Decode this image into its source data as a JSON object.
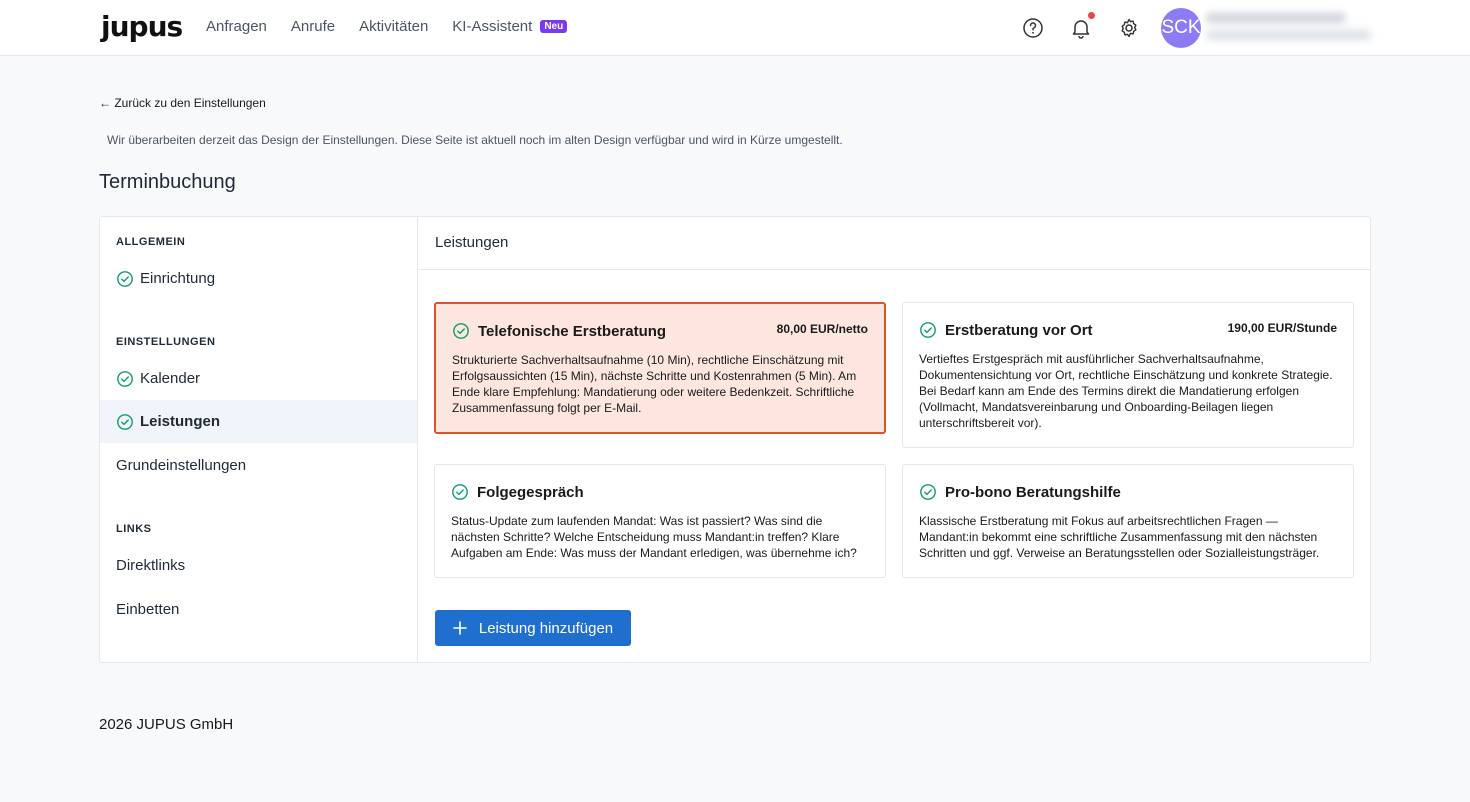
{
  "nav": {
    "logo": "jupus",
    "links": [
      "Anfragen",
      "Anrufe",
      "Aktivitäten",
      "KI-Assistent"
    ],
    "new_badge": "Neu",
    "avatar_initials": "SCK"
  },
  "page": {
    "back_link": "← Zurück zu den Einstellungen",
    "notice": "Wir überarbeiten derzeit das Design der Einstellungen. Diese Seite ist aktuell noch im alten Design verfügbar und wird in Kürze umgestellt.",
    "title": "Terminbuchung"
  },
  "sidebar": {
    "sections": [
      {
        "title": "ALLGEMEIN",
        "items": [
          {
            "label": "Einrichtung",
            "checked": true
          }
        ]
      },
      {
        "title": "EINSTELLUNGEN",
        "items": [
          {
            "label": "Kalender",
            "checked": true
          },
          {
            "label": "Leistungen",
            "checked": true,
            "active": true
          },
          {
            "label": "Grundeinstellungen",
            "checked": false
          }
        ]
      },
      {
        "title": "LINKS",
        "items": [
          {
            "label": "Direktlinks",
            "checked": false
          },
          {
            "label": "Einbetten",
            "checked": false
          }
        ]
      }
    ]
  },
  "content": {
    "header": "Leistungen",
    "services": [
      {
        "title": "Telefonische Erstberatung",
        "price": "80,00 EUR/netto",
        "selected": true,
        "description": "Strukturierte Sachverhaltsaufnahme (10 Min), rechtliche Einschätzung mit Erfolgsaussichten (15 Min), nächste Schritte und Kostenrahmen (5 Min). Am Ende klare Empfehlung: Mandatierung oder weitere Bedenkzeit. Schriftliche Zusammenfassung folgt per E-Mail."
      },
      {
        "title": "Erstberatung vor Ort",
        "price": "190,00 EUR/Stunde",
        "selected": false,
        "description": "Vertieftes Erstgespräch mit ausführlicher Sachverhaltsaufnahme, Dokumentensichtung vor Ort, rechtliche Einschätzung und konkrete Strategie. Bei Bedarf kann am Ende des Termins direkt die Mandatierung erfolgen (Vollmacht, Mandatsvereinbarung und Onboarding-Beilagen liegen unterschriftsbereit vor)."
      },
      {
        "title": "Folgegespräch",
        "price": "",
        "selected": false,
        "description": "Status-Update zum laufenden Mandat: Was ist passiert? Was sind die nächsten Schritte? Welche Entscheidung muss Mandant:in treffen? Klare Aufgaben am Ende: Was muss der Mandant erledigen, was übernehme ich?"
      },
      {
        "title": "Pro-bono Beratungshilfe",
        "price": "",
        "selected": false,
        "description": "Klassische Erstberatung mit Fokus auf arbeitsrechtlichen Fragen — Mandant:in bekommt eine schriftliche Zusammenfassung mit den nächsten Schritten und ggf. Verweise an Beratungsstellen oder Sozialleistungsträger."
      }
    ],
    "add_button": "Leistung hinzufügen"
  },
  "footer": "2026 JUPUS GmbH",
  "colors": {
    "accent": "#1f6fcf",
    "check": "#0f9d6b",
    "selected_bg": "#fde6df",
    "selected_border": "#d9532f",
    "badge": "#7c3aed"
  }
}
